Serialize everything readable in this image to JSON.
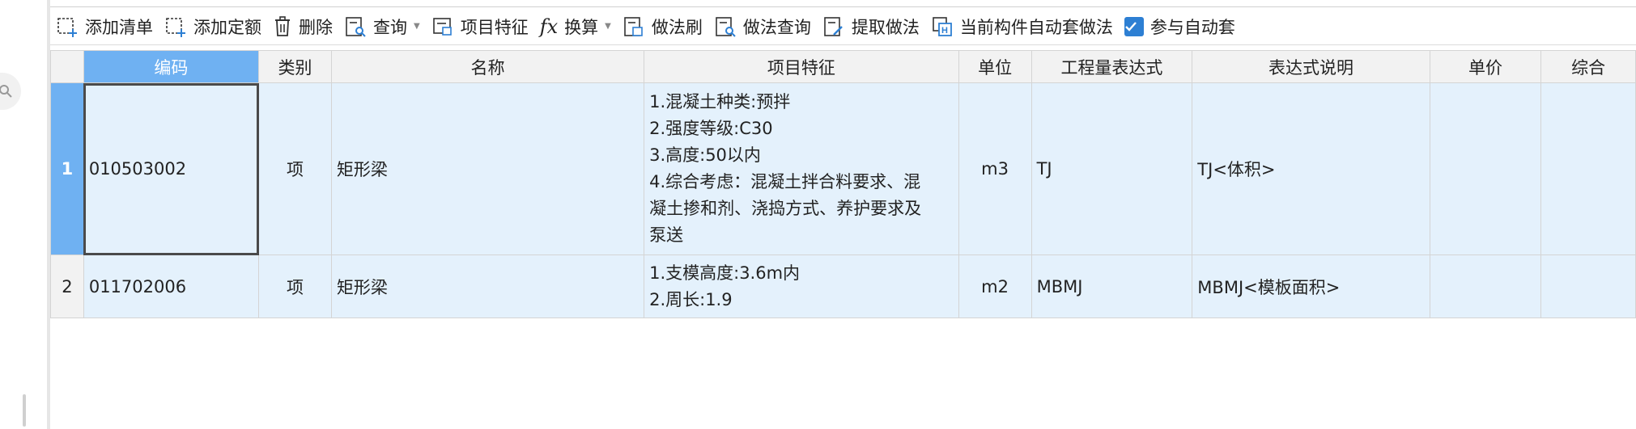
{
  "toolbar": {
    "add_list": "添加清单",
    "add_quota": "添加定额",
    "delete": "删除",
    "query": "查询",
    "item_feature": "项目特征",
    "convert": "换算",
    "method_brush": "做法刷",
    "method_query": "做法查询",
    "extract_method": "提取做法",
    "auto_apply_current": "当前构件自动套做法",
    "join_auto_apply": "参与自动套",
    "join_auto_apply_checked": true,
    "fx_symbol": "fx"
  },
  "table": {
    "headers": {
      "code": "编码",
      "category": "类别",
      "name": "名称",
      "feature": "项目特征",
      "unit": "单位",
      "expr": "工程量表达式",
      "expr_desc": "表达式说明",
      "price": "单价",
      "combined": "综合"
    },
    "rows": [
      {
        "num": "1",
        "code": "010503002",
        "category": "项",
        "name": "矩形梁",
        "feature_lines": [
          "1.混凝土种类:预拌",
          "2.强度等级:C30",
          "3.高度:50以内",
          "4.综合考虑：混凝土拌合料要求、混",
          "凝土掺和剂、浇捣方式、养护要求及",
          "泵送"
        ],
        "unit": "m3",
        "expr": "TJ",
        "expr_desc": "TJ<体积>"
      },
      {
        "num": "2",
        "code": "011702006",
        "category": "项",
        "name": "矩形梁",
        "feature_lines": [
          "1.支模高度:3.6m内",
          "2.周长:1.9"
        ],
        "unit": "m2",
        "expr": "MBMJ",
        "expr_desc": "MBMJ<模板面积>"
      }
    ]
  },
  "colors": {
    "header_active": "#6fb1f2",
    "row_bg": "#e4f1fc",
    "checkbox": "#2d7fd3"
  }
}
